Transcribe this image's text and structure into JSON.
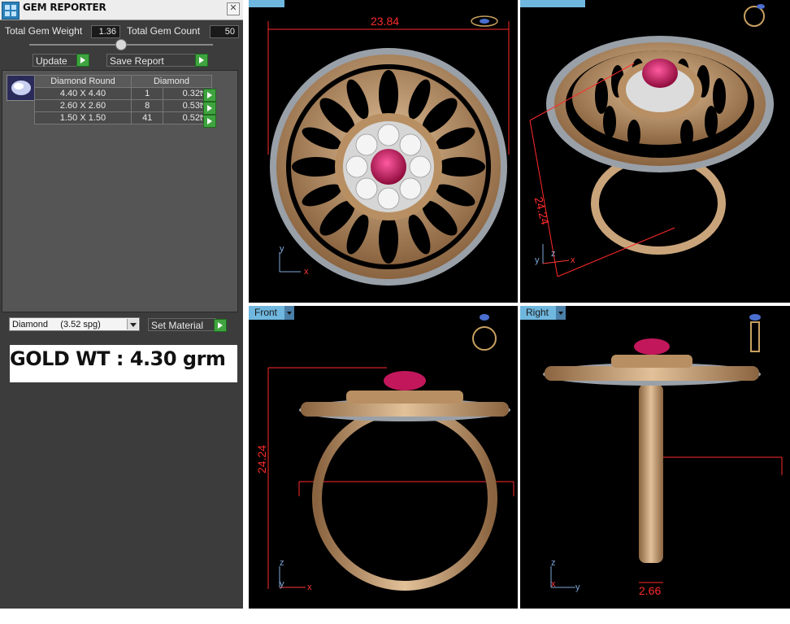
{
  "window": {
    "title": "GEM REPORTER",
    "close": "✕"
  },
  "stats": {
    "weight_label": "Total Gem Weight",
    "weight_value": "1.36",
    "count_label": "Total Gem Count",
    "count_value": "50"
  },
  "toolbar": {
    "update_label": "Update",
    "save_label": "Save Report"
  },
  "gem_table": {
    "headers": [
      "Diamond Round",
      "Diamond"
    ],
    "rows": [
      {
        "size": "4.40 X 4.40",
        "count": "1",
        "weight": "0.32tw"
      },
      {
        "size": "2.60 X 2.60",
        "count": "8",
        "weight": "0.53tw"
      },
      {
        "size": "1.50 X 1.50",
        "count": "41",
        "weight": "0.52tw"
      }
    ]
  },
  "material": {
    "selected": "Diamond     (3.52 spg)",
    "set_label": "Set Material"
  },
  "gold_weight": "GOLD WT : 4.30 grm",
  "viewports": {
    "top": {
      "dimension": "23.84",
      "axes": {
        "y": "y",
        "x": "x"
      }
    },
    "perspective": {
      "dimension": "24.24",
      "axes": {
        "y": "y",
        "z": "z",
        "x": "x"
      }
    },
    "front": {
      "label": "Front",
      "dimension": "24.24",
      "axes": {
        "z": "z",
        "y": "y",
        "x": "x"
      }
    },
    "right": {
      "label": "Right",
      "dimension": "2.66",
      "axes": {
        "z": "z",
        "x": "x",
        "y": "y"
      }
    }
  },
  "colors": {
    "accent": "#6fb7de",
    "dimension": "#ff2a2a",
    "gold": "#c9a47a",
    "ruby": "#c2185b"
  }
}
